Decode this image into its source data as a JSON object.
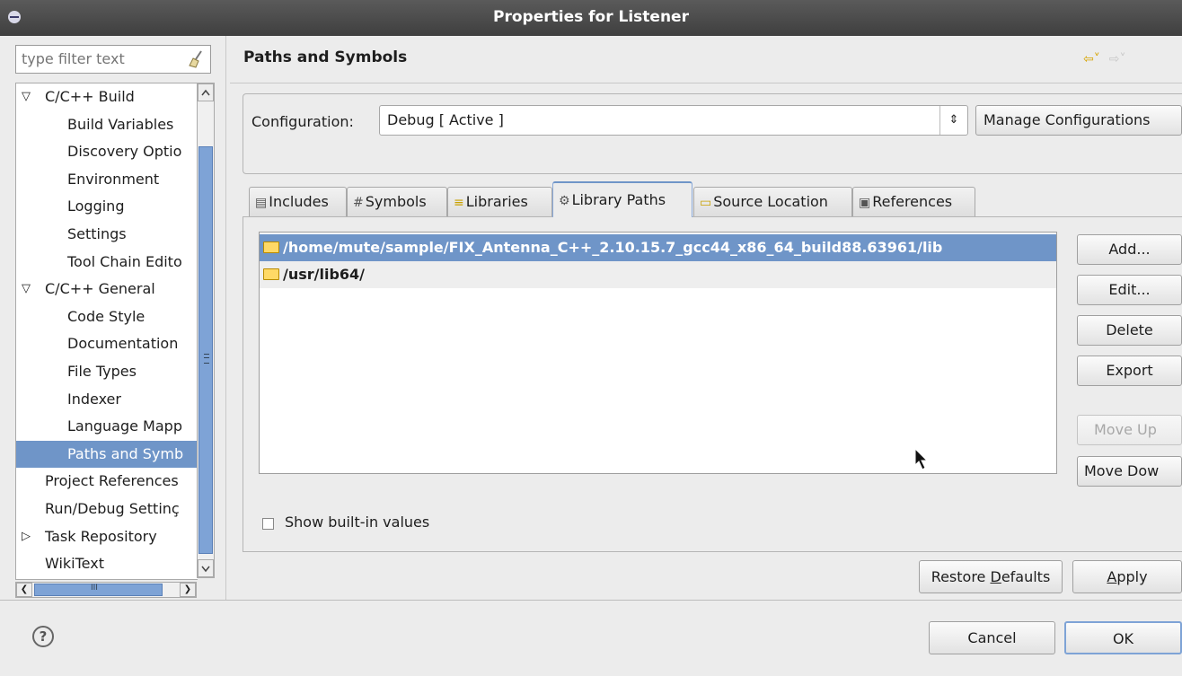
{
  "window": {
    "title": "Properties for Listener"
  },
  "filter": {
    "placeholder": "type filter text"
  },
  "tree": {
    "items": [
      {
        "label": "C/C++ Build",
        "depth": 0,
        "expander": "expanded"
      },
      {
        "label": "Build Variables",
        "depth": 1
      },
      {
        "label": "Discovery Optio",
        "depth": 1
      },
      {
        "label": "Environment",
        "depth": 1
      },
      {
        "label": "Logging",
        "depth": 1
      },
      {
        "label": "Settings",
        "depth": 1
      },
      {
        "label": "Tool Chain Edito",
        "depth": 1
      },
      {
        "label": "C/C++ General",
        "depth": 0,
        "expander": "expanded"
      },
      {
        "label": "Code Style",
        "depth": 1
      },
      {
        "label": "Documentation",
        "depth": 1
      },
      {
        "label": "File Types",
        "depth": 1
      },
      {
        "label": "Indexer",
        "depth": 1
      },
      {
        "label": "Language Mapp",
        "depth": 1
      },
      {
        "label": "Paths and Symb",
        "depth": 1,
        "selected": true
      },
      {
        "label": "Project References",
        "depth": 0
      },
      {
        "label": "Run/Debug Settinç",
        "depth": 0
      },
      {
        "label": "Task Repository",
        "depth": 0,
        "expander": "collapsed"
      },
      {
        "label": "WikiText",
        "depth": 0
      }
    ],
    "hscroll_grip": "III"
  },
  "page": {
    "title": "Paths and Symbols",
    "configuration_label": "Configuration:",
    "configuration_value": "Debug  [ Active ]",
    "manage_button": "Manage Configurations",
    "tabs": [
      {
        "label": "Includes",
        "icon": "includes-icon"
      },
      {
        "label": "Symbols",
        "icon": "hash-icon"
      },
      {
        "label": "Libraries",
        "icon": "libraries-icon"
      },
      {
        "label": "Library Paths",
        "icon": "library-paths-icon",
        "active": true
      },
      {
        "label": "Source Location",
        "icon": "folder-icon"
      },
      {
        "label": "References",
        "icon": "references-icon"
      }
    ],
    "paths": [
      {
        "path": "/home/mute/sample/FIX_Antenna_C++_2.10.15.7_gcc44_x86_64_build88.63961/lib",
        "selected": true
      },
      {
        "path": "/usr/lib64/"
      }
    ],
    "side_buttons": {
      "add": "Add...",
      "edit": "Edit...",
      "delete": "Delete",
      "export": "Export",
      "move_up": "Move Up",
      "move_down": "Move Dow"
    },
    "show_builtin_label": "Show built-in values",
    "show_builtin_checked": false,
    "restore_defaults": "Restore Defaults",
    "restore_mnemonic": "D",
    "apply": "Apply",
    "apply_mnemonic": "A"
  },
  "footer": {
    "cancel": "Cancel",
    "ok": "OK"
  },
  "colors": {
    "selection": "#6f95c8",
    "title_bar": "#464646",
    "accent_arrow": "#d6a400"
  }
}
